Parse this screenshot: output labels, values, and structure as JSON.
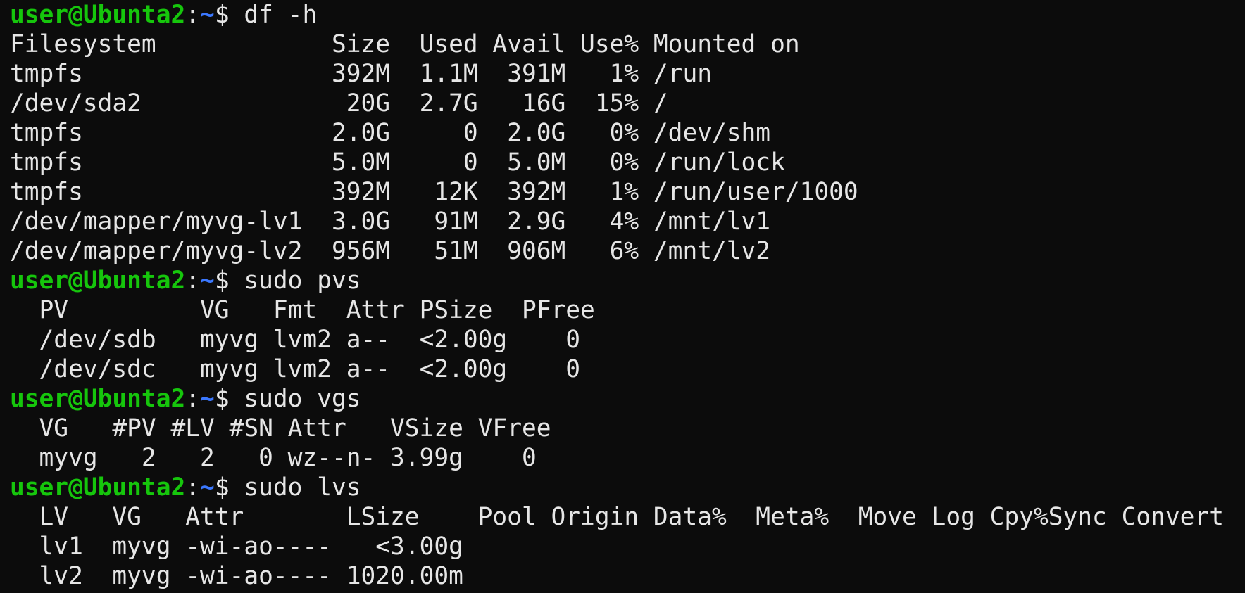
{
  "terminal": {
    "colors": {
      "background": "#0c0c0c",
      "foreground": "#e6e6e6",
      "prompt_user": "#16c60c",
      "prompt_path": "#3b78ff"
    },
    "prompt": {
      "user_host": "user@Ubunta2",
      "colon": ":",
      "path": "~",
      "dollar": "$ "
    },
    "commands": [
      {
        "command": "df -h",
        "output": [
          "Filesystem            Size  Used Avail Use% Mounted on",
          "tmpfs                 392M  1.1M  391M   1% /run",
          "/dev/sda2              20G  2.7G   16G  15% /",
          "tmpfs                 2.0G     0  2.0G   0% /dev/shm",
          "tmpfs                 5.0M     0  5.0M   0% /run/lock",
          "tmpfs                 392M   12K  392M   1% /run/user/1000",
          "/dev/mapper/myvg-lv1  3.0G   91M  2.9G   4% /mnt/lv1",
          "/dev/mapper/myvg-lv2  956M   51M  906M   6% /mnt/lv2"
        ]
      },
      {
        "command": "sudo pvs",
        "output": [
          "  PV         VG   Fmt  Attr PSize  PFree",
          "  /dev/sdb   myvg lvm2 a--  <2.00g    0",
          "  /dev/sdc   myvg lvm2 a--  <2.00g    0"
        ]
      },
      {
        "command": "sudo vgs",
        "output": [
          "  VG   #PV #LV #SN Attr   VSize VFree",
          "  myvg   2   2   0 wz--n- 3.99g    0"
        ]
      },
      {
        "command": "sudo lvs",
        "output": [
          "  LV   VG   Attr       LSize    Pool Origin Data%  Meta%  Move Log Cpy%Sync Convert",
          "  lv1  myvg -wi-ao----   <3.00g",
          "  lv2  myvg -wi-ao---- 1020.00m"
        ]
      }
    ]
  }
}
